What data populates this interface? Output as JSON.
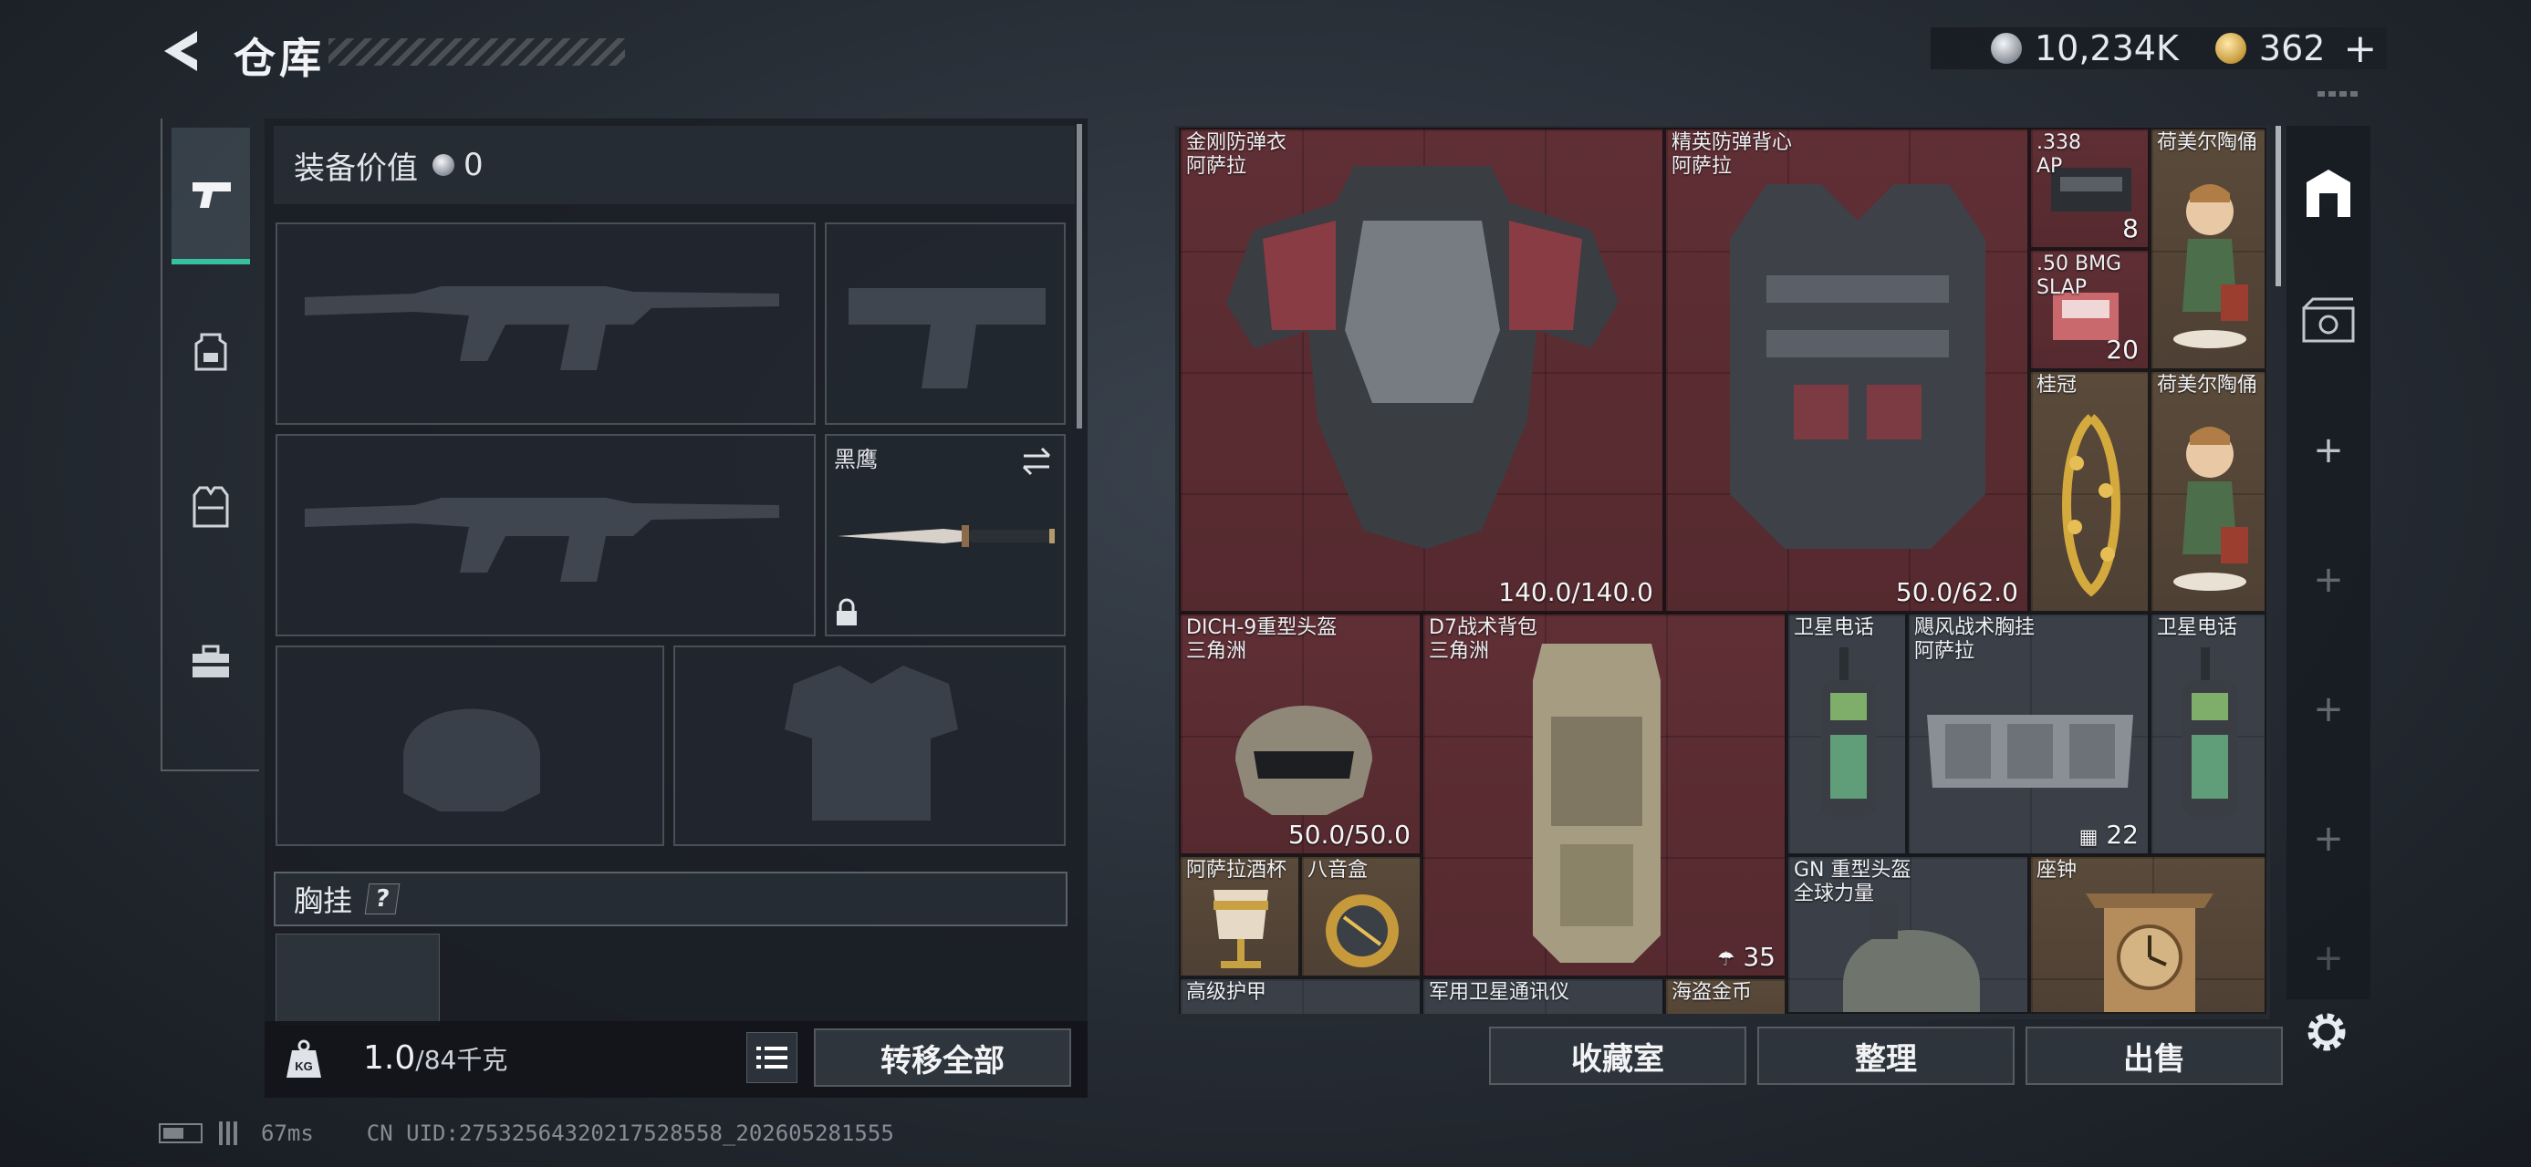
{
  "header": {
    "title": "仓库",
    "currency_silver": "10,234K",
    "currency_gold": "362",
    "add_label": "+"
  },
  "categories": [
    {
      "icon": "pistol-icon",
      "active": true
    },
    {
      "icon": "backpack-icon",
      "active": false
    },
    {
      "icon": "vest-icon",
      "active": false
    },
    {
      "icon": "toolbox-icon",
      "active": false
    }
  ],
  "loadout": {
    "value_label": "装备价值",
    "value": "0",
    "melee_name": "黑鹰",
    "rig_label": "胸挂",
    "help_label": "?",
    "weight_current": "1.0",
    "weight_max": "/84千克",
    "transfer_all": "转移全部"
  },
  "items": [
    {
      "name": "金刚防弹衣\n阿萨拉",
      "value": "140.0/140.0"
    },
    {
      "name": "精英防弹背心\n阿萨拉",
      "value": "50.0/62.0"
    },
    {
      "name": ".338\nAP",
      "value": "8"
    },
    {
      "name": "荷美尔陶俑",
      "value": ""
    },
    {
      "name": ".50 BMG\nSLAP",
      "value": "20"
    },
    {
      "name": "桂冠",
      "value": ""
    },
    {
      "name": "荷美尔陶俑",
      "value": ""
    },
    {
      "name": "DICH-9重型头盔\n三角洲",
      "value": "50.0/50.0"
    },
    {
      "name": "D7战术背包\n三角洲",
      "value": "35"
    },
    {
      "name": "卫星电话",
      "value": ""
    },
    {
      "name": "飓风战术胸挂\n阿萨拉",
      "value": "22"
    },
    {
      "name": "卫星电话",
      "value": ""
    },
    {
      "name": "阿萨拉酒杯",
      "value": ""
    },
    {
      "name": "八音盒",
      "value": ""
    },
    {
      "name": "GN 重型头盔\n全球力量",
      "value": ""
    },
    {
      "name": "座钟",
      "value": ""
    },
    {
      "name": "高级护甲",
      "value": ""
    },
    {
      "name": "军用卫星通讯仪",
      "value": ""
    },
    {
      "name": "海盗金币",
      "value": ""
    }
  ],
  "actions": {
    "collection": "收藏室",
    "sort": "整理",
    "sell": "出售"
  },
  "rail_plus": "+",
  "status": {
    "ping": "67ms",
    "uid": "CN UID:27532564320217528558_202605281555"
  },
  "colors": {
    "accent": "#36c2a0",
    "rarity_red": "#5f2f35",
    "rarity_gold": "#5a4a3a"
  }
}
